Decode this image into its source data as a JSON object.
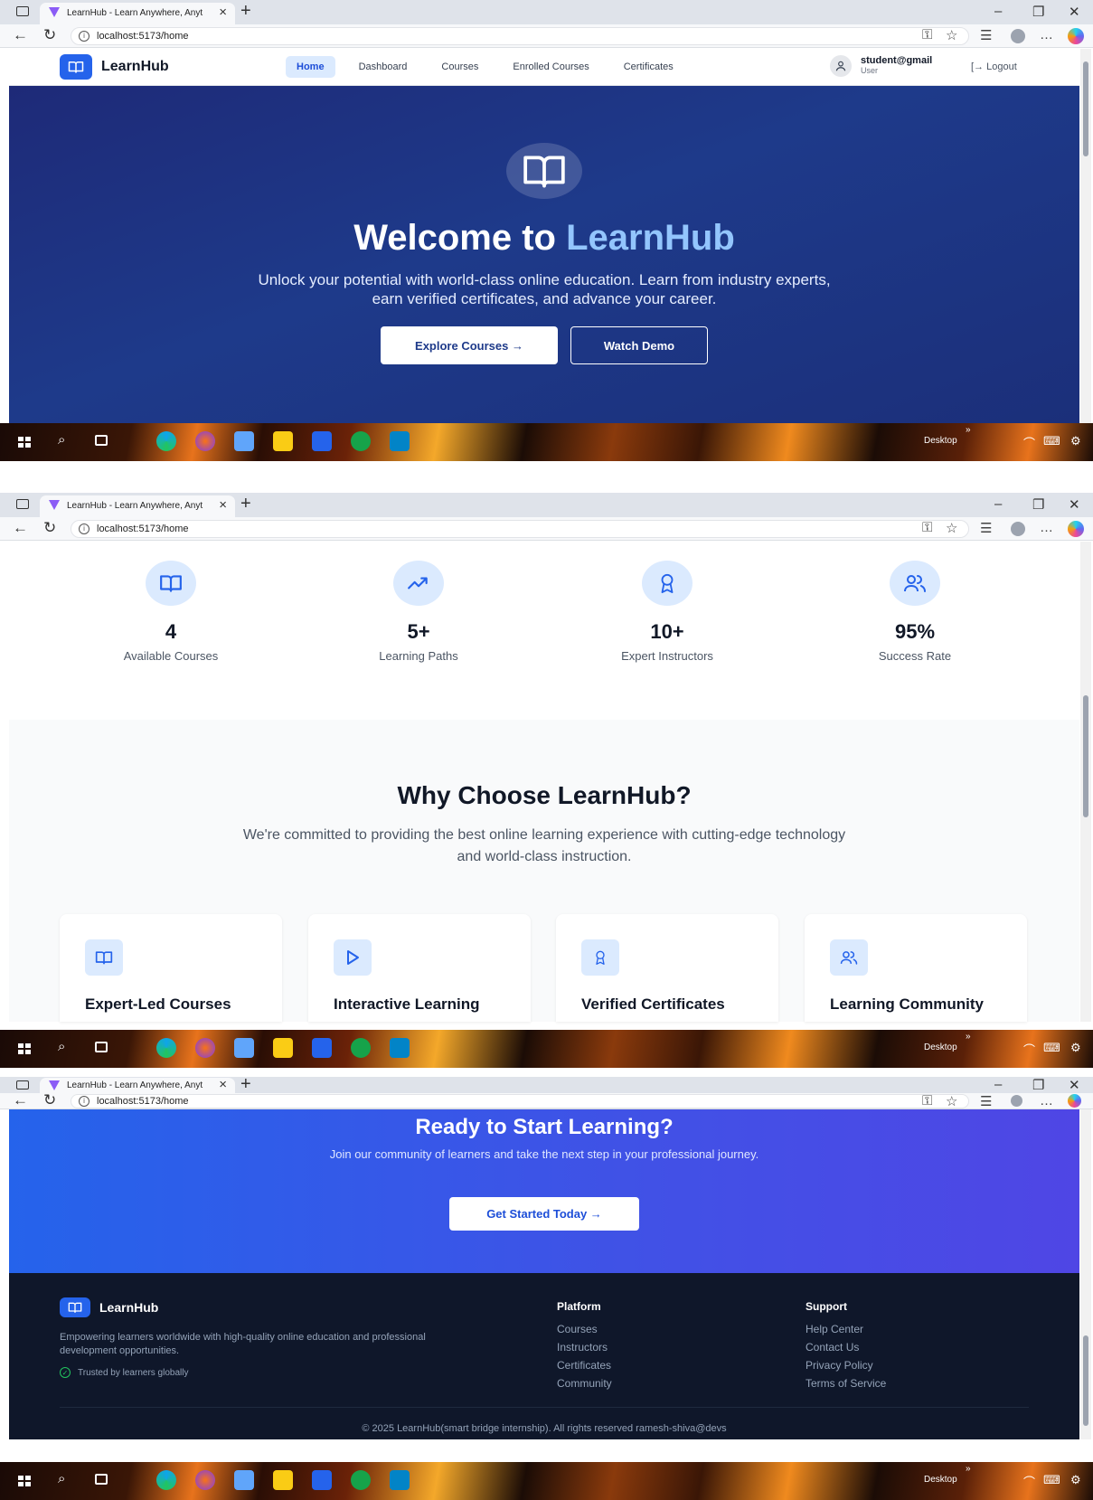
{
  "browser": {
    "tab_title": "LearnHub - Learn Anywhere, Anyt",
    "url": "localhost:5173/home"
  },
  "taskbar": {
    "desktop_label": "Desktop"
  },
  "header": {
    "brand": "LearnHub",
    "nav": [
      "Home",
      "Dashboard",
      "Courses",
      "Enrolled Courses",
      "Certificates"
    ],
    "active_nav": "Home",
    "user_email": "student@gmail",
    "user_role": "User",
    "logout": "Logout"
  },
  "hero": {
    "title_part1": "Welcome to ",
    "title_part2": "LearnHub",
    "subtitle": "Unlock your potential with world-class online education. Learn from industry experts, earn verified certificates, and advance your career.",
    "primary_button": "Explore Courses →",
    "secondary_button": "Watch Demo"
  },
  "stats": [
    {
      "value": "4",
      "label": "Available Courses",
      "icon": "book-icon"
    },
    {
      "value": "5+",
      "label": "Learning Paths",
      "icon": "trending-up-icon"
    },
    {
      "value": "10+",
      "label": "Expert Instructors",
      "icon": "award-icon"
    },
    {
      "value": "95%",
      "label": "Success Rate",
      "icon": "users-icon"
    }
  ],
  "why": {
    "title": "Why Choose LearnHub?",
    "subtitle": "We're committed to providing the best online learning experience with cutting-edge technology and world-class instruction.",
    "features": [
      {
        "title": "Expert-Led Courses",
        "icon": "book-icon"
      },
      {
        "title": "Interactive Learning",
        "icon": "play-icon"
      },
      {
        "title": "Verified Certificates",
        "icon": "award-icon"
      },
      {
        "title": "Learning Community",
        "icon": "users-icon"
      }
    ]
  },
  "cta": {
    "title": "Ready to Start Learning?",
    "subtitle": "Join our community of learners and take the next step in your professional journey.",
    "button": "Get Started Today →"
  },
  "footer": {
    "brand": "LearnHub",
    "description": "Empowering learners worldwide with high-quality online education and professional development opportunities.",
    "trusted": "Trusted by learners globally",
    "platform_heading": "Platform",
    "platform_links": [
      "Courses",
      "Instructors",
      "Certificates",
      "Community"
    ],
    "support_heading": "Support",
    "support_links": [
      "Help Center",
      "Contact Us",
      "Privacy Policy",
      "Terms of Service"
    ],
    "copyright": "© 2025 LearnHub(smart bridge internship). All rights reserved ramesh-shiva@devs"
  },
  "colors": {
    "primary": "#2563eb",
    "hero_bg": "#1e3a8a",
    "hero_accent": "#93c5fd",
    "footer_bg": "#0f172a"
  }
}
